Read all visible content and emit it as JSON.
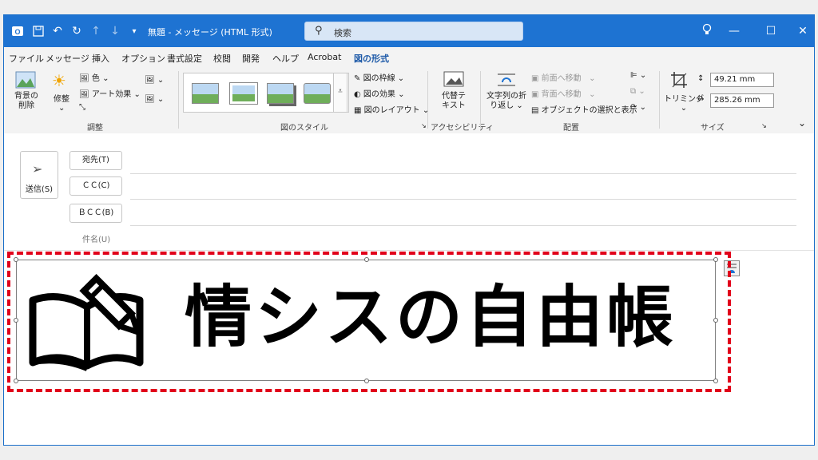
{
  "titlebar": {
    "title": "無題 - メッセージ (HTML 形式)",
    "search_placeholder": "検索",
    "accent": "#1e73d2"
  },
  "menu": {
    "items": [
      "ファイル",
      "メッセージ",
      "挿入",
      "オプション",
      "書式設定",
      "校閲",
      "開発",
      "ヘルプ",
      "Acrobat",
      "図の形式"
    ],
    "active": "図の形式"
  },
  "ribbon": {
    "adjust": {
      "label": "調整",
      "remove_bg": "背景の削除",
      "corrections": "修整",
      "color": "色",
      "art_effects": "アート効果"
    },
    "styles": {
      "label": "図のスタイル",
      "border": "図の枠線",
      "effects": "図の効果",
      "layout": "図のレイアウト"
    },
    "accessibility": {
      "label": "アクセシビリティ",
      "alt_text_1": "代替テ",
      "alt_text_2": "キスト"
    },
    "arrange": {
      "label": "配置",
      "wrap_1": "文字列の折",
      "wrap_2": "り返し",
      "bring_forward": "前面へ移動",
      "send_backward": "背面へ移動",
      "selection_pane": "オブジェクトの選択と表示"
    },
    "size": {
      "label": "サイズ",
      "crop": "トリミング",
      "height": "49.21 mm",
      "width": "285.26 mm"
    }
  },
  "compose": {
    "send": "送信(S)",
    "to": "宛先(T)",
    "cc": "ＣＣ(C)",
    "bcc": "ＢＣＣ(B)",
    "subject": "件名(U)"
  },
  "image": {
    "text": "情シスの自由帳",
    "highlight_color": "#e1001a"
  }
}
